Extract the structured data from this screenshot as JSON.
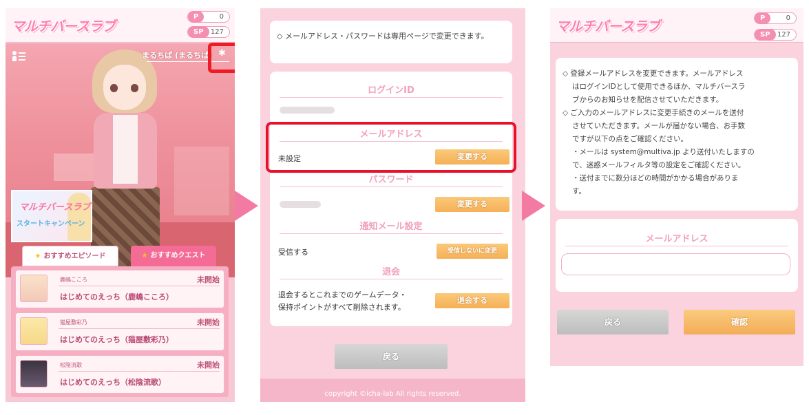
{
  "header": {
    "logo_text": "マルチバースラブ",
    "points_label": "P",
    "points_value": "0",
    "sp_label": "SP",
    "sp_value": "127"
  },
  "home": {
    "user_name": "まるちぱ (まるちぱ)",
    "banner_title": "マルチバースラブ",
    "banner_subtitle": "スタートキャンペーン",
    "tabs": [
      "おすすめエピソード",
      "おすすめクエスト"
    ],
    "quests": [
      {
        "character": "鹿嶋こころ",
        "title": "はじめてのえっち（鹿嶋こころ）",
        "status": "未開始"
      },
      {
        "character": "猫屋敷彩乃",
        "title": "はじめてのえっち（猫屋敷彩乃）",
        "status": "未開始"
      },
      {
        "character": "松陰流歌",
        "title": "はじめてのえっち（松陰流歌）",
        "status": "未開始"
      }
    ]
  },
  "settings": {
    "notice": "◇ メールアドレス・パスワードは専用ページで変更できます。",
    "login_id_title": "ログインID",
    "email_title": "メールアドレス",
    "email_value": "未設定",
    "change_label": "変更する",
    "password_title": "パスワード",
    "notify_title": "通知メール設定",
    "notify_value": "受信する",
    "notify_button": "受信しないに変更",
    "withdraw_title": "退会",
    "withdraw_text_line1": "退会するとこれまでのゲームデータ・",
    "withdraw_text_line2": "保持ポイントがすべて削除されます。",
    "withdraw_button": "退会する",
    "back_button": "戻る",
    "copyright": "copyright ©icha-lab All rights reserved."
  },
  "email_change": {
    "notes": [
      "◇ 登録メールアドレスを変更できます。メールアドレス",
      "はログインIDとして使用できるほか、マルチバースラ",
      "ブからのお知らせを配信させていただきます。",
      "◇ ご入力のメールアドレスに変更手続きのメールを送付",
      "させていただきます。メールが届かない場合、お手数",
      "ですが以下の点をご確認ください。",
      "・メールは system@multiva.jp より送付いたしますの",
      "で、迷惑メールフィルタ等の設定をご確認ください。",
      "・送付までに数分ほどの時間がかかる場合がありま",
      "す。"
    ],
    "field_title": "メールアドレス",
    "back_button": "戻る",
    "confirm_button": "確認"
  },
  "colors": {
    "accent_pink": "#f46b96",
    "highlight_red": "#e8112a",
    "button_orange": "#f5b057"
  }
}
